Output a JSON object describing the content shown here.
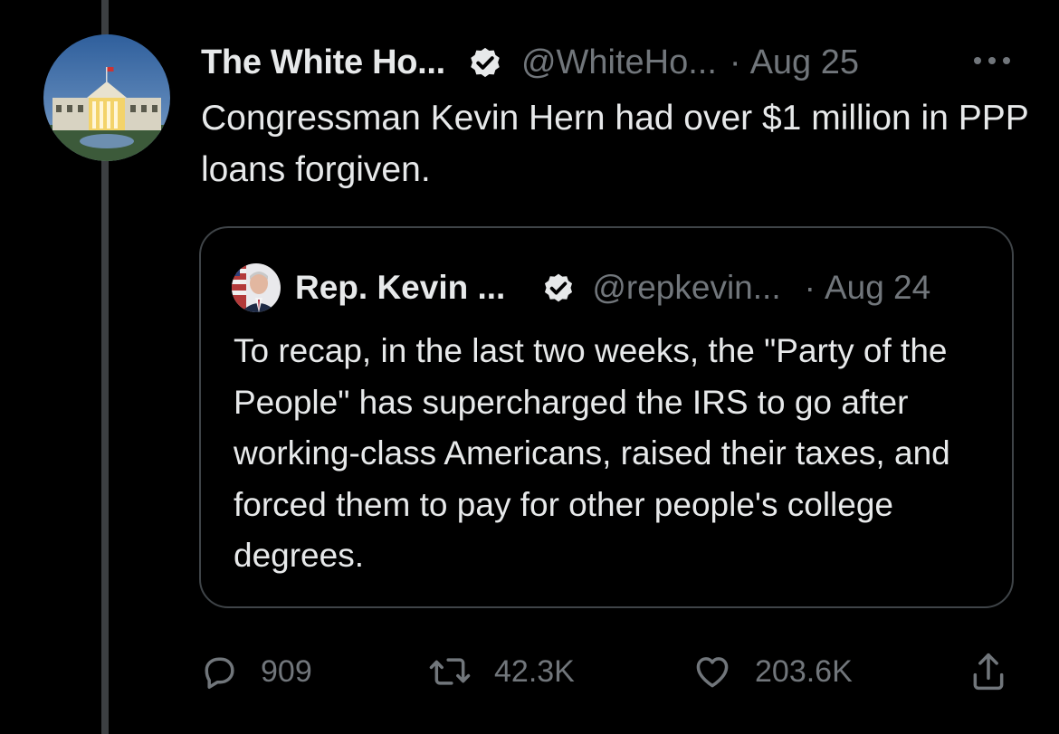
{
  "tweet": {
    "display_name": "The White Ho...",
    "handle": "@WhiteHo...",
    "separator": "·",
    "date": "Aug 25",
    "text": "Congressman Kevin Hern had over $1 million in PPP loans forgiven.",
    "avatar": "white-house-photo",
    "verified_icon": "verified-badge-icon",
    "more_icon": "more-options-icon"
  },
  "quoted": {
    "display_name": "Rep. Kevin ...",
    "handle": "@repkevin...",
    "separator": "·",
    "date": "Aug 24",
    "text": "To recap, in the last two weeks, the \"Party of the People\" has supercharged the IRS to go after working-class Americans, raised their taxes, and forced them to pay for other people's college degrees.",
    "avatar": "portrait-with-flag-photo",
    "verified_icon": "verified-badge-icon"
  },
  "actions": {
    "reply": {
      "icon": "reply-icon",
      "count": "909"
    },
    "retweet": {
      "icon": "retweet-icon",
      "count": "42.3K"
    },
    "like": {
      "icon": "heart-icon",
      "count": "203.6K"
    },
    "share": {
      "icon": "share-icon"
    }
  },
  "colors": {
    "background": "#000000",
    "primary_text": "#e7e9ea",
    "secondary_text": "#71767b",
    "border": "#3f4448",
    "thread_line": "#3c3f42"
  }
}
